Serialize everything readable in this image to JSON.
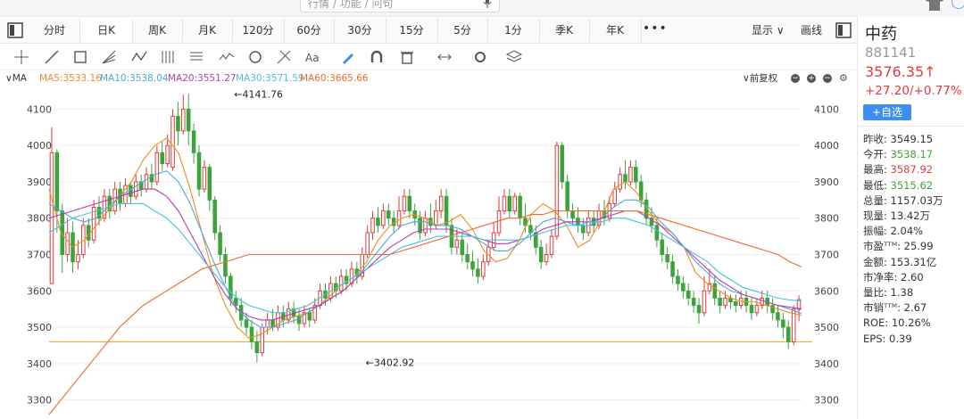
{
  "search": {
    "placeholder": "行情 / 功能 / 问句"
  },
  "periods": [
    {
      "label": "分时",
      "active": false
    },
    {
      "label": "日K",
      "active": true
    },
    {
      "label": "周K",
      "active": false
    },
    {
      "label": "月K",
      "active": false
    },
    {
      "label": "120分",
      "active": false
    },
    {
      "label": "60分",
      "active": false
    },
    {
      "label": "30分",
      "active": false
    },
    {
      "label": "15分",
      "active": false
    },
    {
      "label": "5分",
      "active": false
    },
    {
      "label": "1分",
      "active": false
    },
    {
      "label": "季K",
      "active": false
    },
    {
      "label": "年K",
      "active": false
    }
  ],
  "period_more": "•••",
  "display_label": "显示",
  "draw_label": "画线",
  "tools": [
    "crosshair-icon",
    "line-icon",
    "rect-icon",
    "fan-icon",
    "wave-icon",
    "channel-icon",
    "text-lines-icon",
    "zigzag-icon",
    "cycle-icon",
    "fib-icon",
    "text-icon",
    "pen-icon",
    "magnet-icon",
    "trash-icon",
    "hand-icon",
    "settings-icon",
    "layers-icon"
  ],
  "ma_bar": {
    "toggle": "MA",
    "items": [
      {
        "label": "MA5:3533.16",
        "color": "#f08a24"
      },
      {
        "label": "MA10:3538.04",
        "color": "#4ea8de"
      },
      {
        "label": "MA20:3551.27",
        "color": "#b23fb0"
      },
      {
        "label": "MA30:3571.59",
        "color": "#47c1e0"
      },
      {
        "label": "MA60:3665.66",
        "color": "#ee6a2e"
      }
    ],
    "adjust": "前复权"
  },
  "stock": {
    "name": "中药",
    "code": "881141",
    "price": "3576.35↑",
    "change": "+27.20/+0.77%",
    "add_button": "+自选"
  },
  "stats": [
    {
      "label": "昨收:",
      "value": "3549.15",
      "cls": ""
    },
    {
      "label": "今开:",
      "value": "3538.17",
      "cls": "green"
    },
    {
      "label": "最高:",
      "value": "3587.92",
      "cls": "red"
    },
    {
      "label": "最低:",
      "value": "3515.62",
      "cls": "green"
    },
    {
      "label": "总量:",
      "value": "1157.03万",
      "cls": ""
    },
    {
      "label": "现量:",
      "value": "13.42万",
      "cls": ""
    },
    {
      "label": "振幅:",
      "value": "2.04%",
      "cls": ""
    },
    {
      "label": "市盈ᵀᵀᴹ:",
      "value": "25.99",
      "cls": ""
    },
    {
      "label": "金额:",
      "value": "153.31亿",
      "cls": ""
    },
    {
      "label": "市净率:",
      "value": "2.60",
      "cls": ""
    },
    {
      "label": "量比:",
      "value": "1.38",
      "cls": ""
    },
    {
      "label": "市销ᵀᵀᴹ:",
      "value": "2.67",
      "cls": ""
    },
    {
      "label": "ROE:",
      "value": "10.26%",
      "cls": ""
    },
    {
      "label": "EPS:",
      "value": "0.39",
      "cls": ""
    }
  ],
  "chart_data": {
    "type": "candlestick",
    "ylim": [
      3250,
      4150
    ],
    "yticks": [
      3300,
      3400,
      3500,
      3600,
      3700,
      3800,
      3900,
      4000,
      4100
    ],
    "grid": true,
    "up_color": "#e03b3b",
    "down_color": "#3aa53a",
    "annotations": [
      {
        "text": "←4141.76",
        "index": 35,
        "y": 4141.76
      },
      {
        "text": "←3402.92",
        "index": 60,
        "y": 3402.92
      }
    ],
    "reference_line": {
      "y": 3460,
      "color": "#f0a020"
    },
    "candles": [
      [
        3620,
        3980,
        3700,
        4050
      ],
      [
        3980,
        3820,
        3760,
        3990
      ],
      [
        3820,
        3700,
        3650,
        3840
      ],
      [
        3700,
        3760,
        3680,
        3800
      ],
      [
        3760,
        3680,
        3650,
        3790
      ],
      [
        3680,
        3700,
        3660,
        3740
      ],
      [
        3700,
        3780,
        3690,
        3800
      ],
      [
        3780,
        3740,
        3720,
        3800
      ],
      [
        3740,
        3830,
        3730,
        3850
      ],
      [
        3830,
        3800,
        3780,
        3860
      ],
      [
        3800,
        3860,
        3790,
        3880
      ],
      [
        3860,
        3820,
        3800,
        3880
      ],
      [
        3820,
        3880,
        3810,
        3900
      ],
      [
        3880,
        3840,
        3820,
        3900
      ],
      [
        3840,
        3890,
        3830,
        3910
      ],
      [
        3890,
        3860,
        3840,
        3900
      ],
      [
        3860,
        3900,
        3850,
        3920
      ],
      [
        3900,
        3880,
        3860,
        3920
      ],
      [
        3880,
        3920,
        3870,
        3940
      ],
      [
        3920,
        3900,
        3880,
        3950
      ],
      [
        3900,
        3980,
        3890,
        4000
      ],
      [
        3980,
        3950,
        3930,
        4010
      ],
      [
        3950,
        4000,
        3940,
        4030
      ],
      [
        3940,
        4080,
        3930,
        4100
      ],
      [
        4080,
        4040,
        4000,
        4120
      ],
      [
        4040,
        4100,
        4030,
        4140
      ],
      [
        4100,
        4040,
        4000,
        4142
      ],
      [
        4040,
        3980,
        3950,
        4060
      ],
      [
        3980,
        3880,
        3860,
        4000
      ],
      [
        3880,
        3940,
        3870,
        3960
      ],
      [
        3940,
        3850,
        3820,
        3950
      ],
      [
        3850,
        3760,
        3740,
        3860
      ],
      [
        3760,
        3700,
        3680,
        3780
      ],
      [
        3700,
        3640,
        3620,
        3720
      ],
      [
        3640,
        3580,
        3560,
        3650
      ],
      [
        3580,
        3560,
        3540,
        3600
      ],
      [
        3560,
        3520,
        3500,
        3580
      ],
      [
        3520,
        3500,
        3480,
        3540
      ],
      [
        3500,
        3460,
        3440,
        3520
      ],
      [
        3460,
        3430,
        3403,
        3490
      ],
      [
        3430,
        3500,
        3420,
        3510
      ],
      [
        3500,
        3520,
        3480,
        3540
      ],
      [
        3520,
        3500,
        3490,
        3550
      ],
      [
        3500,
        3540,
        3490,
        3560
      ],
      [
        3540,
        3520,
        3500,
        3560
      ],
      [
        3520,
        3550,
        3510,
        3570
      ],
      [
        3550,
        3530,
        3510,
        3570
      ],
      [
        3530,
        3510,
        3490,
        3550
      ],
      [
        3510,
        3540,
        3500,
        3560
      ],
      [
        3540,
        3520,
        3500,
        3550
      ],
      [
        3520,
        3560,
        3510,
        3580
      ],
      [
        3560,
        3600,
        3550,
        3620
      ],
      [
        3600,
        3580,
        3560,
        3620
      ],
      [
        3580,
        3620,
        3570,
        3640
      ],
      [
        3620,
        3600,
        3580,
        3640
      ],
      [
        3600,
        3640,
        3590,
        3660
      ],
      [
        3640,
        3620,
        3600,
        3660
      ],
      [
        3620,
        3660,
        3610,
        3680
      ],
      [
        3660,
        3640,
        3620,
        3680
      ],
      [
        3640,
        3700,
        3630,
        3720
      ],
      [
        3700,
        3760,
        3690,
        3780
      ],
      [
        3760,
        3800,
        3740,
        3820
      ],
      [
        3800,
        3780,
        3760,
        3830
      ],
      [
        3780,
        3820,
        3770,
        3840
      ],
      [
        3820,
        3800,
        3780,
        3840
      ],
      [
        3800,
        3780,
        3760,
        3820
      ],
      [
        3780,
        3820,
        3770,
        3860
      ],
      [
        3820,
        3860,
        3810,
        3880
      ],
      [
        3860,
        3820,
        3800,
        3880
      ],
      [
        3820,
        3800,
        3780,
        3840
      ],
      [
        3800,
        3760,
        3740,
        3820
      ],
      [
        3760,
        3800,
        3750,
        3820
      ],
      [
        3800,
        3780,
        3760,
        3840
      ],
      [
        3780,
        3820,
        3770,
        3850
      ],
      [
        3820,
        3860,
        3800,
        3880
      ],
      [
        3860,
        3780,
        3760,
        3880
      ],
      [
        3780,
        3720,
        3700,
        3800
      ],
      [
        3720,
        3740,
        3700,
        3770
      ],
      [
        3740,
        3700,
        3680,
        3760
      ],
      [
        3700,
        3680,
        3660,
        3730
      ],
      [
        3680,
        3660,
        3640,
        3710
      ],
      [
        3660,
        3640,
        3620,
        3690
      ],
      [
        3640,
        3680,
        3630,
        3700
      ],
      [
        3680,
        3720,
        3670,
        3740
      ],
      [
        3720,
        3760,
        3710,
        3790
      ],
      [
        3760,
        3820,
        3750,
        3860
      ],
      [
        3820,
        3860,
        3810,
        3880
      ],
      [
        3860,
        3820,
        3800,
        3880
      ],
      [
        3820,
        3860,
        3810,
        3870
      ],
      [
        3860,
        3800,
        3780,
        3870
      ],
      [
        3800,
        3780,
        3760,
        3840
      ],
      [
        3780,
        3760,
        3740,
        3800
      ],
      [
        3760,
        3720,
        3700,
        3780
      ],
      [
        3720,
        3680,
        3660,
        3740
      ],
      [
        3680,
        3700,
        3670,
        3730
      ],
      [
        3700,
        3750,
        3690,
        3770
      ],
      [
        3750,
        4000,
        3740,
        4010
      ],
      [
        4000,
        3900,
        3880,
        4010
      ],
      [
        3900,
        3820,
        3800,
        3920
      ],
      [
        3820,
        3800,
        3780,
        3840
      ],
      [
        3800,
        3780,
        3760,
        3830
      ],
      [
        3780,
        3760,
        3740,
        3800
      ],
      [
        3760,
        3800,
        3750,
        3820
      ],
      [
        3800,
        3780,
        3760,
        3820
      ],
      [
        3780,
        3820,
        3770,
        3840
      ],
      [
        3820,
        3800,
        3780,
        3850
      ],
      [
        3800,
        3840,
        3790,
        3860
      ],
      [
        3840,
        3880,
        3830,
        3900
      ],
      [
        3880,
        3920,
        3870,
        3940
      ],
      [
        3920,
        3900,
        3880,
        3960
      ],
      [
        3900,
        3940,
        3890,
        3960
      ],
      [
        3940,
        3900,
        3880,
        3960
      ],
      [
        3900,
        3850,
        3830,
        3920
      ],
      [
        3850,
        3800,
        3780,
        3870
      ],
      [
        3800,
        3780,
        3760,
        3830
      ],
      [
        3780,
        3740,
        3720,
        3800
      ],
      [
        3740,
        3700,
        3680,
        3760
      ],
      [
        3700,
        3680,
        3660,
        3720
      ],
      [
        3680,
        3640,
        3620,
        3700
      ],
      [
        3640,
        3620,
        3600,
        3660
      ],
      [
        3620,
        3600,
        3580,
        3640
      ],
      [
        3600,
        3580,
        3560,
        3620
      ],
      [
        3580,
        3560,
        3540,
        3600
      ],
      [
        3560,
        3540,
        3510,
        3580
      ],
      [
        3540,
        3600,
        3530,
        3640
      ],
      [
        3600,
        3620,
        3590,
        3660
      ],
      [
        3620,
        3580,
        3560,
        3640
      ],
      [
        3580,
        3560,
        3540,
        3600
      ],
      [
        3560,
        3580,
        3550,
        3600
      ],
      [
        3580,
        3570,
        3550,
        3590
      ],
      [
        3570,
        3560,
        3540,
        3590
      ],
      [
        3560,
        3580,
        3550,
        3600
      ],
      [
        3580,
        3560,
        3540,
        3600
      ],
      [
        3560,
        3540,
        3520,
        3580
      ],
      [
        3540,
        3560,
        3530,
        3580
      ],
      [
        3560,
        3580,
        3550,
        3600
      ],
      [
        3580,
        3560,
        3540,
        3600
      ],
      [
        3560,
        3540,
        3520,
        3580
      ],
      [
        3540,
        3520,
        3500,
        3560
      ],
      [
        3520,
        3500,
        3470,
        3540
      ],
      [
        3500,
        3460,
        3440,
        3520
      ],
      [
        3460,
        3550,
        3450,
        3560
      ],
      [
        3549,
        3576,
        3516,
        3588
      ]
    ],
    "ma_lines": [
      {
        "name": "MA5",
        "color": "#f08a24",
        "values": [
          3880,
          3760,
          3720,
          3740,
          3780,
          3820,
          3860,
          3900,
          3960,
          4000,
          4020,
          3980,
          3880,
          3760,
          3640,
          3560,
          3500,
          3470,
          3480,
          3500,
          3520,
          3530,
          3540,
          3560,
          3590,
          3620,
          3640,
          3680,
          3740,
          3780,
          3800,
          3810,
          3800,
          3780,
          3790,
          3810,
          3770,
          3710,
          3680,
          3690,
          3740,
          3810,
          3840,
          3820,
          3780,
          3720,
          3740,
          3800,
          3880,
          3900,
          3870,
          3820,
          3780,
          3760,
          3720,
          3650,
          3620,
          3600,
          3580,
          3570,
          3570,
          3560,
          3550,
          3540,
          3533
        ]
      },
      {
        "name": "MA10",
        "color": "#4ea8de",
        "values": [
          3840,
          3820,
          3800,
          3790,
          3800,
          3830,
          3860,
          3880,
          3900,
          3920,
          3930,
          3900,
          3840,
          3760,
          3680,
          3610,
          3550,
          3520,
          3500,
          3500,
          3510,
          3520,
          3540,
          3560,
          3580,
          3600,
          3630,
          3670,
          3710,
          3750,
          3780,
          3790,
          3790,
          3780,
          3780,
          3770,
          3750,
          3730,
          3710,
          3710,
          3730,
          3760,
          3790,
          3800,
          3790,
          3780,
          3780,
          3800,
          3830,
          3850,
          3850,
          3830,
          3790,
          3760,
          3720,
          3680,
          3650,
          3620,
          3600,
          3590,
          3580,
          3570,
          3560,
          3550,
          3538
        ]
      },
      {
        "name": "MA20",
        "color": "#b23fb0",
        "values": [
          3800,
          3810,
          3820,
          3830,
          3840,
          3850,
          3860,
          3870,
          3880,
          3880,
          3860,
          3820,
          3760,
          3700,
          3640,
          3590,
          3550,
          3530,
          3520,
          3520,
          3530,
          3540,
          3550,
          3560,
          3580,
          3600,
          3630,
          3660,
          3690,
          3720,
          3740,
          3760,
          3770,
          3770,
          3770,
          3760,
          3750,
          3740,
          3730,
          3730,
          3740,
          3750,
          3770,
          3780,
          3790,
          3790,
          3790,
          3800,
          3810,
          3820,
          3820,
          3800,
          3780,
          3750,
          3720,
          3690,
          3660,
          3630,
          3610,
          3590,
          3580,
          3570,
          3560,
          3555,
          3551
        ]
      },
      {
        "name": "MA30",
        "color": "#47c1e0",
        "values": [
          3760,
          3780,
          3800,
          3810,
          3820,
          3830,
          3840,
          3840,
          3840,
          3820,
          3800,
          3770,
          3730,
          3690,
          3650,
          3610,
          3580,
          3560,
          3550,
          3540,
          3540,
          3550,
          3560,
          3580,
          3600,
          3620,
          3640,
          3660,
          3680,
          3700,
          3720,
          3730,
          3740,
          3750,
          3750,
          3750,
          3750,
          3740,
          3740,
          3740,
          3740,
          3750,
          3760,
          3770,
          3780,
          3780,
          3790,
          3790,
          3800,
          3800,
          3790,
          3780,
          3760,
          3740,
          3720,
          3700,
          3680,
          3650,
          3630,
          3610,
          3600,
          3590,
          3580,
          3575,
          3572
        ]
      },
      {
        "name": "MA60",
        "color": "#ee6a2e",
        "values": [
          3260,
          3300,
          3340,
          3380,
          3420,
          3460,
          3500,
          3530,
          3560,
          3580,
          3600,
          3620,
          3640,
          3660,
          3670,
          3680,
          3690,
          3700,
          3700,
          3700,
          3700,
          3700,
          3700,
          3700,
          3700,
          3700,
          3700,
          3700,
          3700,
          3700,
          3710,
          3720,
          3730,
          3740,
          3750,
          3760,
          3770,
          3780,
          3790,
          3800,
          3800,
          3810,
          3810,
          3820,
          3820,
          3820,
          3820,
          3820,
          3820,
          3820,
          3820,
          3810,
          3800,
          3790,
          3780,
          3770,
          3760,
          3750,
          3740,
          3730,
          3720,
          3710,
          3700,
          3680,
          3666
        ]
      }
    ]
  }
}
